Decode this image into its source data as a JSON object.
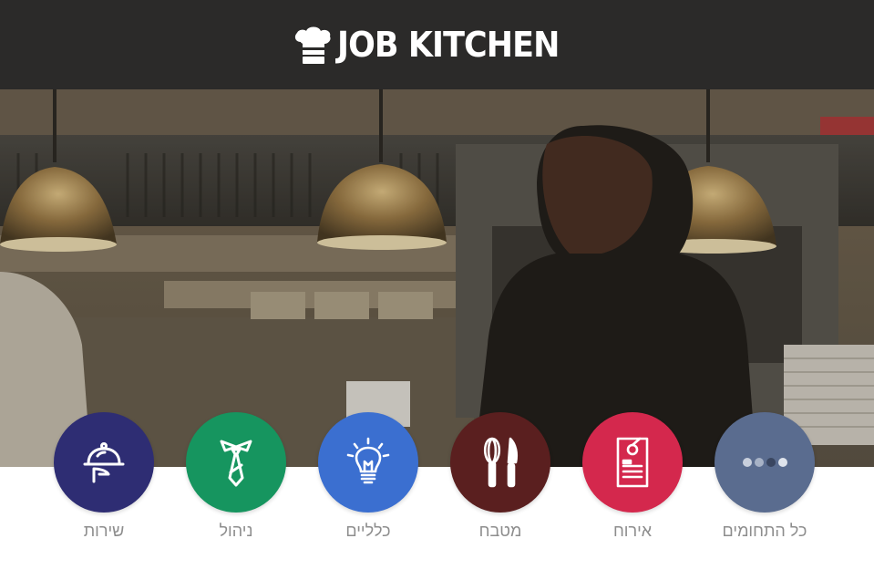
{
  "brand": {
    "logo_text": "JOB KITCHEN",
    "header_bg": "#2b2a29"
  },
  "categories": [
    {
      "label": "שירות",
      "icon": "cloche-icon",
      "color": "#2e2d73"
    },
    {
      "label": "ניהול",
      "icon": "tie-icon",
      "color": "#16955f"
    },
    {
      "label": "כלליים",
      "icon": "lightbulb-icon",
      "color": "#3b6fd0"
    },
    {
      "label": "מטבח",
      "icon": "whisk-knife-icon",
      "color": "#5a1f1f"
    },
    {
      "label": "אירוח",
      "icon": "door-hanger-icon",
      "color": "#d4284d"
    },
    {
      "label": "כל התחומים",
      "icon": "dots-icon",
      "color": "#5a6c8f"
    }
  ]
}
